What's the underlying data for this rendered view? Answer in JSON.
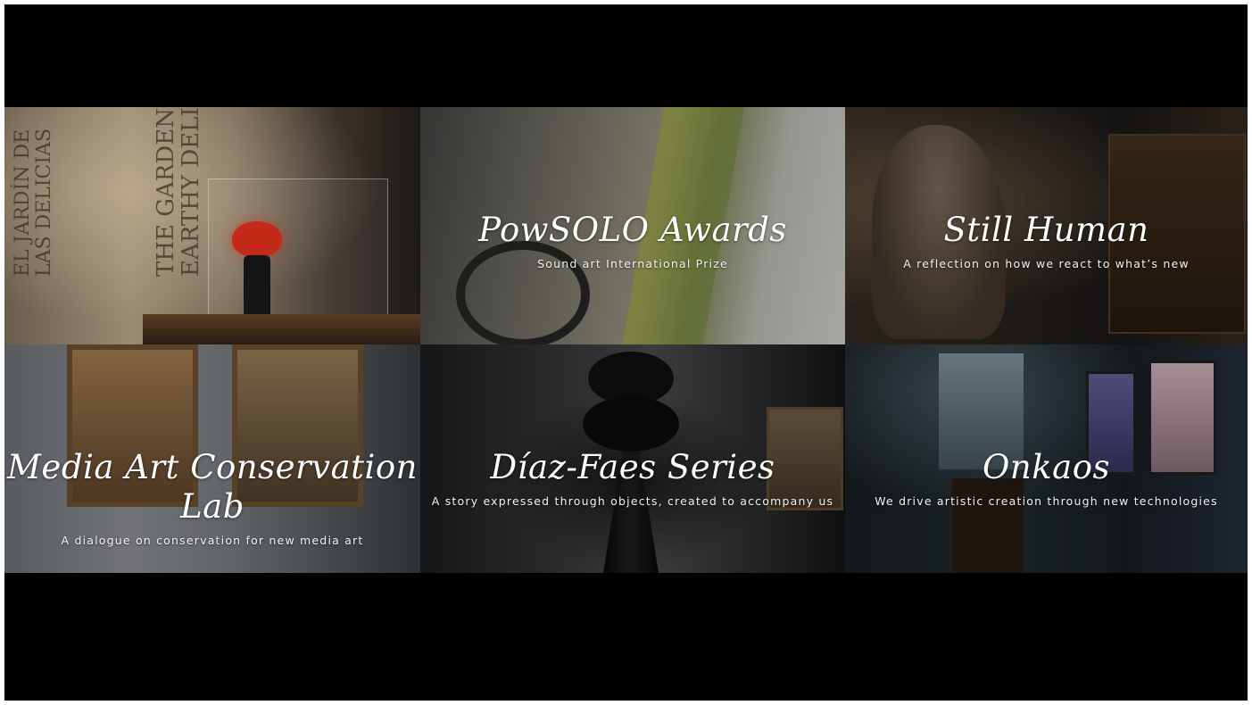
{
  "tiles": [
    {
      "id": "exhibition",
      "title": "",
      "subtitle": "",
      "poster_lines": [
        "EL JARDÍN DE",
        "LAS DELICIAS",
        "THE GARDEN O",
        "EARTHY DELIG"
      ]
    },
    {
      "id": "powsolo",
      "title": "PowSOLO Awards",
      "subtitle": "Sound art International Prize"
    },
    {
      "id": "still-human",
      "title": "Still Human",
      "subtitle": "A reflection on how we react to what’s new"
    },
    {
      "id": "media-art-lab",
      "title_line1": "Media Art Conservation",
      "title_line2": "Lab",
      "subtitle": "A dialogue on conservation for new media art"
    },
    {
      "id": "diaz-faes",
      "title": "Díaz-Faes Series",
      "subtitle": "A story expressed through objects, created to accompany us"
    },
    {
      "id": "onkaos",
      "title": "Onkaos",
      "subtitle": "We drive artistic creation through new technologies"
    }
  ],
  "colors": {
    "frame_background": "#000000",
    "caption_text": "#ffffff"
  }
}
